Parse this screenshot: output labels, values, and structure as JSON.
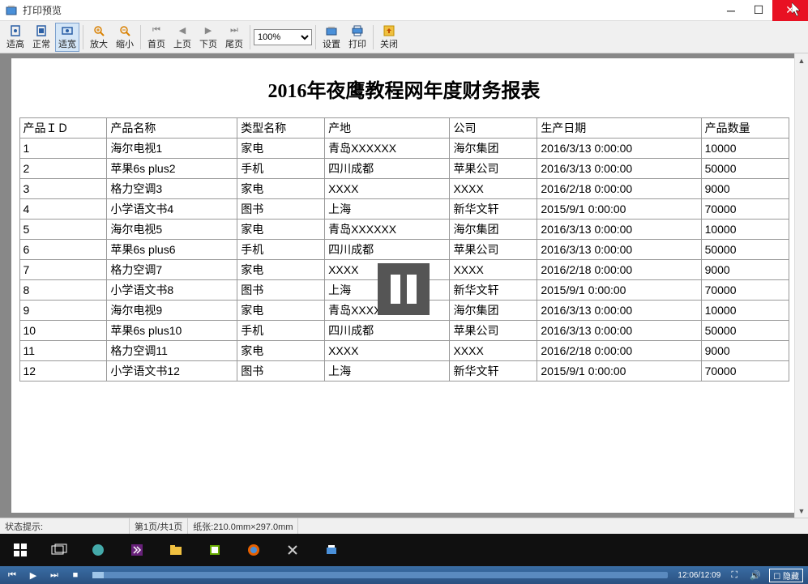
{
  "window": {
    "title": "打印预览"
  },
  "toolbar": {
    "fit_height": "适高",
    "normal": "正常",
    "fit_width": "适宽",
    "zoom_in": "放大",
    "zoom_out": "缩小",
    "first_page": "首页",
    "prev_page": "上页",
    "next_page": "下页",
    "last_page": "尾页",
    "zoom_value": "100%",
    "settings": "设置",
    "print": "打印",
    "close": "关闭"
  },
  "report": {
    "title": "2016年夜鹰教程网年度财务报表",
    "columns": [
      "产品ＩＤ",
      "产品名称",
      "类型名称",
      "产地",
      "公司",
      "生产日期",
      "产品数量"
    ],
    "rows": [
      [
        "1",
        "海尔电视1",
        "家电",
        "青岛XXXXXX",
        "海尔集团",
        "2016/3/13 0:00:00",
        "10000"
      ],
      [
        "2",
        "苹果6s plus2",
        "手机",
        "四川成都",
        "苹果公司",
        "2016/3/13 0:00:00",
        "50000"
      ],
      [
        "3",
        "格力空调3",
        "家电",
        "XXXX",
        "XXXX",
        "2016/2/18 0:00:00",
        "9000"
      ],
      [
        "4",
        "小学语文书4",
        "图书",
        "上海",
        "新华文轩",
        "2015/9/1 0:00:00",
        "70000"
      ],
      [
        "5",
        "海尔电视5",
        "家电",
        "青岛XXXXXX",
        "海尔集团",
        "2016/3/13 0:00:00",
        "10000"
      ],
      [
        "6",
        "苹果6s plus6",
        "手机",
        "四川成都",
        "苹果公司",
        "2016/3/13 0:00:00",
        "50000"
      ],
      [
        "7",
        "格力空调7",
        "家电",
        "XXXX",
        "XXXX",
        "2016/2/18 0:00:00",
        "9000"
      ],
      [
        "8",
        "小学语文书8",
        "图书",
        "上海",
        "新华文轩",
        "2015/9/1 0:00:00",
        "70000"
      ],
      [
        "9",
        "海尔电视9",
        "家电",
        "青岛XXXXXX",
        "海尔集团",
        "2016/3/13 0:00:00",
        "10000"
      ],
      [
        "10",
        "苹果6s plus10",
        "手机",
        "四川成都",
        "苹果公司",
        "2016/3/13 0:00:00",
        "50000"
      ],
      [
        "11",
        "格力空调11",
        "家电",
        "XXXX",
        "XXXX",
        "2016/2/18 0:00:00",
        "9000"
      ],
      [
        "12",
        "小学语文书12",
        "图书",
        "上海",
        "新华文轩",
        "2015/9/1 0:00:00",
        "70000"
      ]
    ]
  },
  "statusbar": {
    "hint_label": "状态提示:",
    "page_info": "第1页/共1页",
    "paper_size": "纸张:210.0mm×297.0mm"
  },
  "mediabar": {
    "time": "12:06/12:09",
    "hide_label": "隐藏"
  }
}
